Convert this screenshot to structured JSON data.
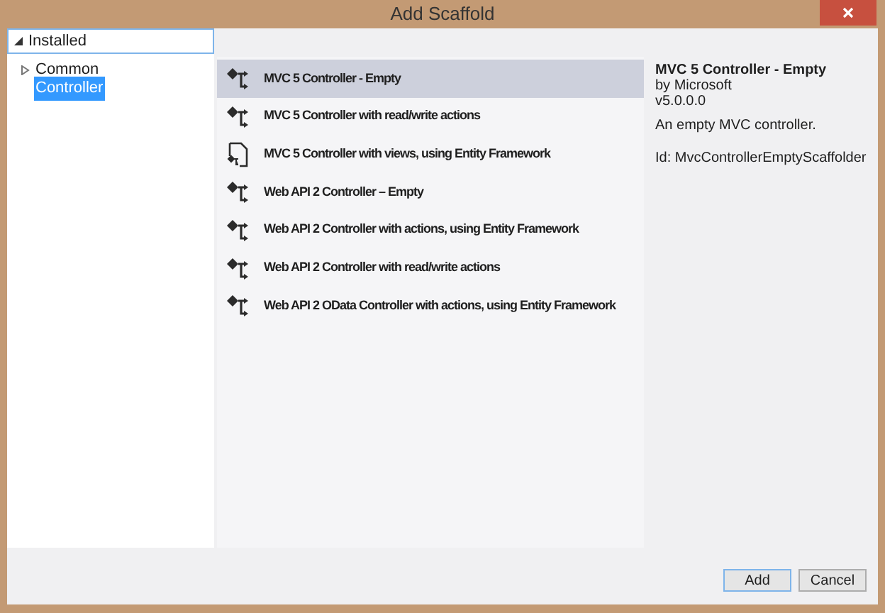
{
  "window": {
    "title": "Add Scaffold"
  },
  "tree": {
    "label": "Installed",
    "expanded": true,
    "children": [
      {
        "label": "Common",
        "expanded": false,
        "selected": false
      },
      {
        "label": "Controller",
        "selected": true
      }
    ]
  },
  "templates": [
    {
      "name": "MVC 5 Controller - Empty",
      "kind": "controller",
      "selected": true
    },
    {
      "name": "MVC 5 Controller with read/write actions",
      "kind": "controller",
      "selected": false
    },
    {
      "name": "MVC 5 Controller with views, using Entity Framework",
      "kind": "views",
      "selected": false
    },
    {
      "name": "Web API 2 Controller – Empty",
      "kind": "controller",
      "selected": false
    },
    {
      "name": "Web API 2 Controller with actions, using Entity Framework",
      "kind": "controller",
      "selected": false
    },
    {
      "name": "Web API 2 Controller with read/write actions",
      "kind": "controller",
      "selected": false
    },
    {
      "name": "Web API 2 OData Controller with actions, using Entity Framework",
      "kind": "controller",
      "selected": false
    }
  ],
  "details": {
    "title": "MVC 5 Controller - Empty",
    "author": "by Microsoft",
    "version": "v5.0.0.0",
    "description": "An empty MVC controller.",
    "id": "Id: MvcControllerEmptyScaffolder"
  },
  "buttons": [
    "Add",
    "Cancel"
  ]
}
